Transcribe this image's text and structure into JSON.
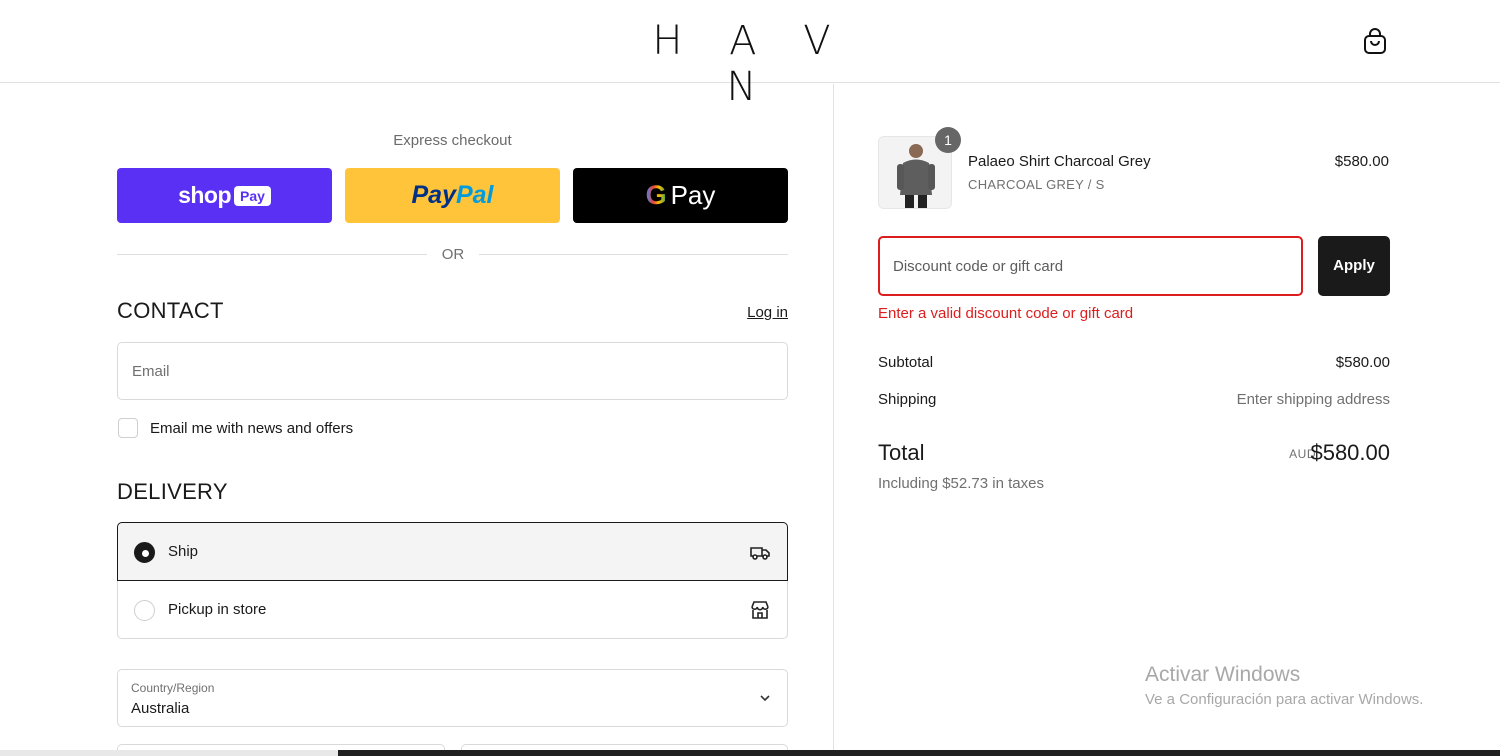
{
  "header": {
    "logo": "H A V N"
  },
  "express": {
    "label": "Express checkout",
    "shop_pay": {
      "word": "shop",
      "badge": "Pay"
    },
    "paypal": {
      "part1": "Pay",
      "part2": "Pal"
    },
    "gpay": {
      "g": "G",
      "word": "Pay"
    },
    "or": "OR"
  },
  "contact": {
    "title": "CONTACT",
    "login": "Log in",
    "email_placeholder": "Email",
    "newsletter_label": "Email me with news and offers"
  },
  "delivery": {
    "title": "DELIVERY",
    "options": [
      {
        "label": "Ship",
        "selected": true,
        "icon": "truck-icon"
      },
      {
        "label": "Pickup in store",
        "selected": false,
        "icon": "store-icon"
      }
    ],
    "country_label": "Country/Region",
    "country_value": "Australia"
  },
  "summary": {
    "item": {
      "quantity": "1",
      "name": "Palaeo Shirt Charcoal Grey",
      "variant": "CHARCOAL GREY / S",
      "price": "$580.00"
    },
    "discount": {
      "placeholder": "Discount code or gift card",
      "apply": "Apply",
      "error": "Enter a valid discount code or gift card"
    },
    "subtotal_label": "Subtotal",
    "subtotal_value": "$580.00",
    "shipping_label": "Shipping",
    "shipping_value": "Enter shipping address",
    "total_label": "Total",
    "total_currency": "AUD",
    "total_value": "$580.00",
    "taxes": "Including $52.73 in taxes"
  },
  "watermark": {
    "title": "Activar Windows",
    "subtitle": "Ve a Configuración para activar Windows."
  },
  "colors": {
    "shop_pay": "#5a31f4",
    "paypal": "#ffc439",
    "error": "#dd1d1d",
    "dark": "#1a1a1a"
  }
}
